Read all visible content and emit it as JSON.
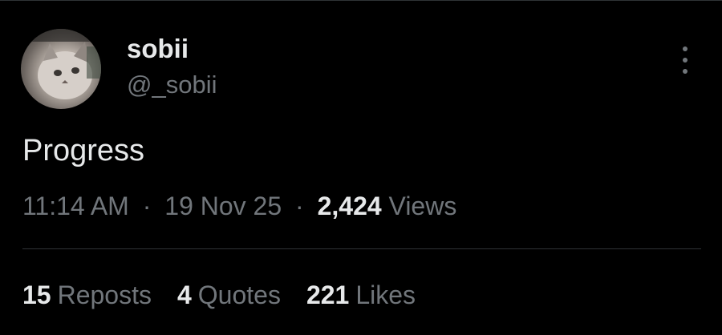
{
  "author": {
    "name": "sobii",
    "handle": "@_sobii"
  },
  "tweet": {
    "text": "Progress",
    "time": "11:14 AM",
    "separator": "·",
    "date": "19 Nov 25",
    "views_count": "2,424",
    "views_label": "Views"
  },
  "stats": [
    {
      "count": "15",
      "label": "Reposts"
    },
    {
      "count": "4",
      "label": "Quotes"
    },
    {
      "count": "221",
      "label": "Likes"
    }
  ],
  "icons": {
    "more": "more-vertical-icon",
    "avatar": "cat-avatar"
  },
  "colors": {
    "background": "#000000",
    "primary_text": "#e7e9ea",
    "secondary_text": "#71767b",
    "divider": "#2f3336"
  }
}
